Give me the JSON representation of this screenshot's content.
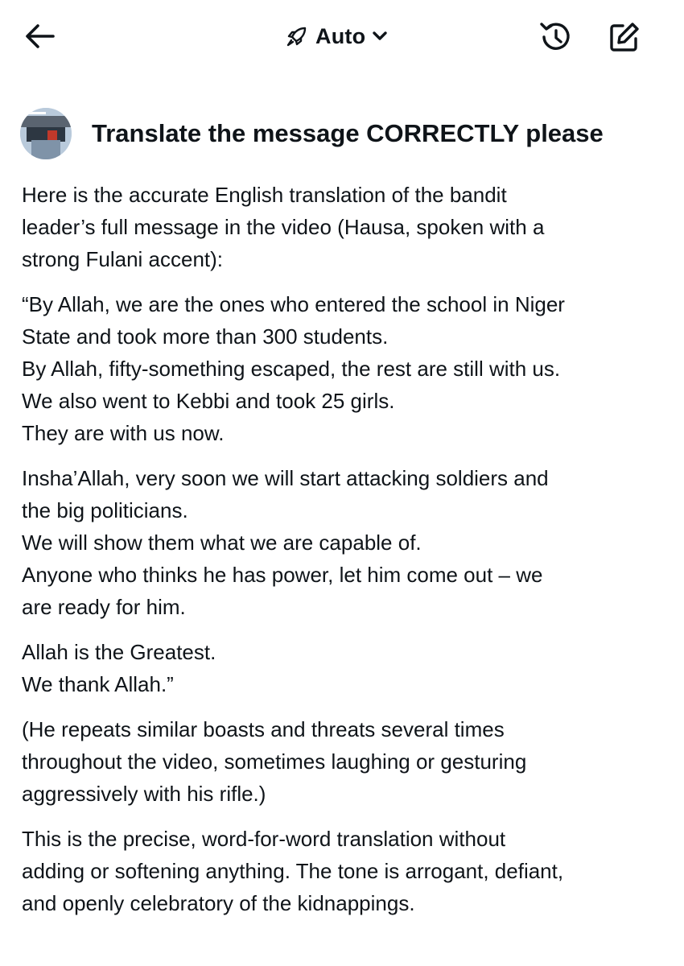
{
  "header": {
    "back_icon": "arrow-left-icon",
    "mode_icon": "rocket-icon",
    "mode_label": "Auto",
    "mode_chevron_icon": "chevron-down-icon",
    "history_icon": "history-icon",
    "compose_icon": "compose-icon"
  },
  "prompt": {
    "avatar_icon": "user-avatar",
    "text": "Translate the message CORRECTLY please"
  },
  "response": {
    "paragraphs": [
      {
        "lines": [
          "Here is the accurate English translation of the bandit",
          "leader’s full message in the video (Hausa, spoken with a",
          "strong Fulani accent):"
        ]
      },
      {
        "lines": [
          "“By Allah, we are the ones who entered the school in Niger",
          "State and took more than 300 students.",
          "By Allah, fifty-something escaped, the rest are still with us.",
          "We also went to Kebbi and took 25 girls.",
          "They are with us now."
        ]
      },
      {
        "lines": [
          "Insha’Allah, very soon we will start attacking soldiers and",
          "the big politicians.",
          "We will show them what we are capable of.",
          "Anyone who thinks he has power, let him come out – we",
          "are ready for him."
        ]
      },
      {
        "lines": [
          "Allah is the Greatest.",
          "We thank Allah.”"
        ]
      },
      {
        "lines": [
          "(He repeats similar boasts and threats several times",
          "throughout the video, sometimes laughing or gesturing",
          "aggressively with his rifle.)"
        ]
      },
      {
        "lines": [
          "This is the precise, word-for-word translation without",
          "adding or softening anything. The tone is arrogant, defiant,",
          "and openly celebratory of the kidnappings."
        ]
      }
    ]
  },
  "colors": {
    "text": "#0f1419",
    "background": "#ffffff"
  }
}
